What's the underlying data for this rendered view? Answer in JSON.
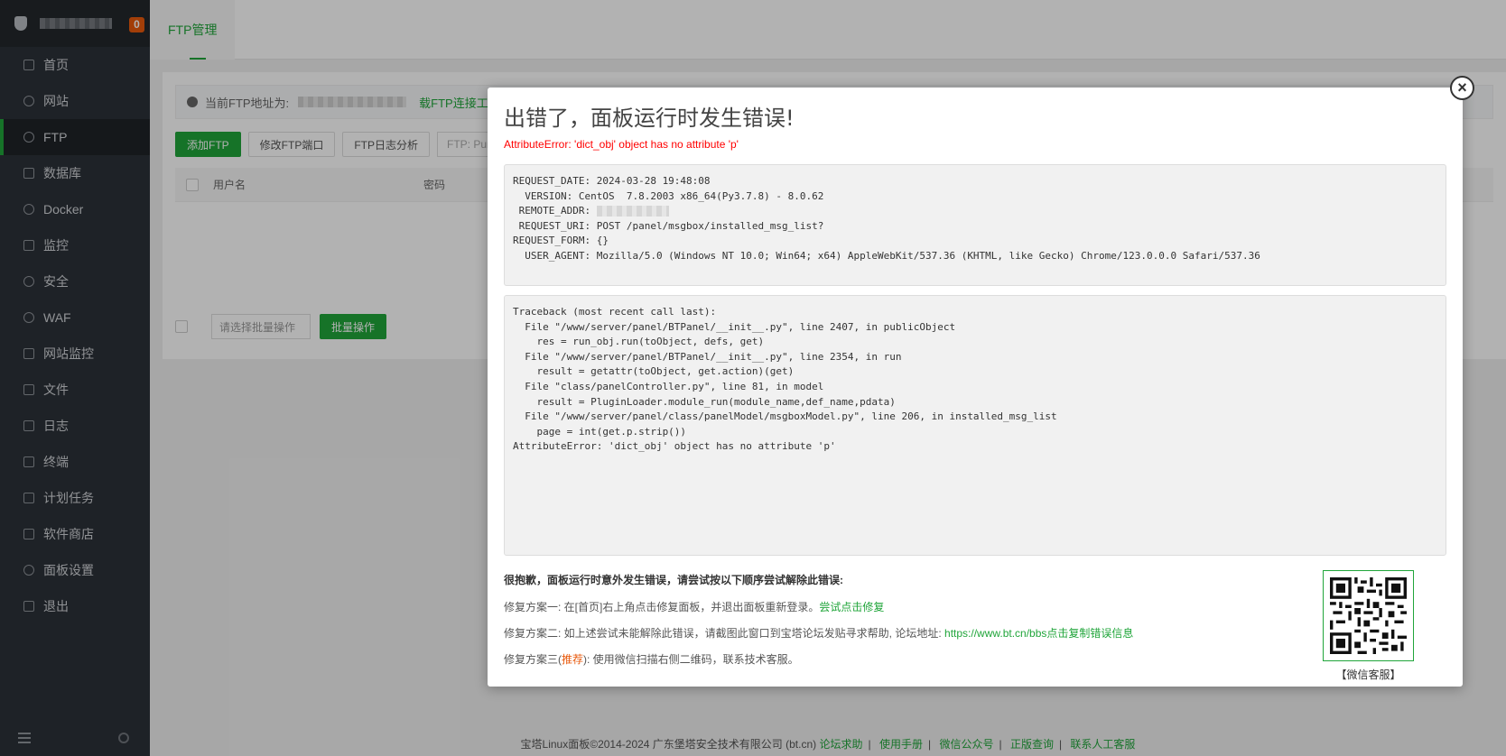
{
  "sidebar": {
    "badge": "0",
    "items": [
      {
        "label": "首页",
        "icon": "home-icon"
      },
      {
        "label": "网站",
        "icon": "globe-icon"
      },
      {
        "label": "FTP",
        "icon": "ftp-icon"
      },
      {
        "label": "数据库",
        "icon": "database-icon"
      },
      {
        "label": "Docker",
        "icon": "docker-icon"
      },
      {
        "label": "监控",
        "icon": "monitor-icon"
      },
      {
        "label": "安全",
        "icon": "shield-icon"
      },
      {
        "label": "WAF",
        "icon": "waf-icon"
      },
      {
        "label": "网站监控",
        "icon": "chart-icon"
      },
      {
        "label": "文件",
        "icon": "folder-icon"
      },
      {
        "label": "日志",
        "icon": "log-icon"
      },
      {
        "label": "终端",
        "icon": "terminal-icon"
      },
      {
        "label": "计划任务",
        "icon": "calendar-icon"
      },
      {
        "label": "软件商店",
        "icon": "apps-icon"
      },
      {
        "label": "面板设置",
        "icon": "gear-icon"
      },
      {
        "label": "退出",
        "icon": "logout-icon"
      }
    ],
    "active_index": 2
  },
  "tabs": {
    "ftp": "FTP管理"
  },
  "ftp_panel": {
    "info_label": "当前FTP地址为:",
    "download_link": "载FTP连接工具",
    "buttons": {
      "add": "添加FTP",
      "port": "修改FTP端口",
      "log": "FTP日志分析"
    },
    "search_placeholder": "FTP:  Pure-",
    "columns": {
      "user": "用户名",
      "pass": "密码"
    },
    "batch_select": "请选择批量操作",
    "batch_button": "批量操作"
  },
  "modal": {
    "title": "出错了，面板运行时发生错误!",
    "error": "AttributeError: 'dict_obj' object has no attribute 'p'",
    "request": {
      "date": "REQUEST_DATE: 2024-03-28 19:48:08",
      "version": "  VERSION: CentOS  7.8.2003 x86_64(Py3.7.8) - 8.0.62",
      "remote": " REMOTE_ADDR: ",
      "uri": " REQUEST_URI: POST /panel/msgbox/installed_msg_list?",
      "form": "REQUEST_FORM: {}",
      "agent": "  USER_AGENT: Mozilla/5.0 (Windows NT 10.0; Win64; x64) AppleWebKit/537.36 (KHTML, like Gecko) Chrome/123.0.0.0 Safari/537.36"
    },
    "traceback": "Traceback (most recent call last):\n  File \"/www/server/panel/BTPanel/__init__.py\", line 2407, in publicObject\n    res = run_obj.run(toObject, defs, get)\n  File \"/www/server/panel/BTPanel/__init__.py\", line 2354, in run\n    result = getattr(toObject, get.action)(get)\n  File \"class/panelController.py\", line 81, in model\n    result = PluginLoader.module_run(module_name,def_name,pdata)\n  File \"/www/server/panel/class/panelModel/msgboxModel.py\", line 206, in installed_msg_list\n    page = int(get.p.strip())\nAttributeError: 'dict_obj' object has no attribute 'p'",
    "help_title": "很抱歉，面板运行时意外发生错误，请尝试按以下顺序尝试解除此错误:",
    "fix1_text": "修复方案一: 在[首页]右上角点击修复面板，并退出面板重新登录。",
    "fix1_link": "尝试点击修复",
    "fix2_text": "修复方案二: 如上述尝试未能解除此错误，请截图此窗口到宝塔论坛发贴寻求帮助, 论坛地址: ",
    "fix2_link": "https://www.bt.cn/bbs",
    "fix2_copy": "点击复制错误信息",
    "fix3_prefix": "修复方案三(",
    "fix3_recommend": "推荐",
    "fix3_suffix": "): 使用微信扫描右侧二维码，联系技术客服。",
    "qr_caption": "【微信客服】"
  },
  "footer": {
    "copyright": "宝塔Linux面板©2014-2024 广东堡塔安全技术有限公司 (bt.cn)",
    "links": [
      "论坛求助",
      "使用手册",
      "微信公众号",
      "正版查询",
      "联系人工客服"
    ]
  },
  "colors": {
    "accent": "#20a53a",
    "error": "#ff0000",
    "badge": "#e8590c",
    "sidebar": "#2c3138"
  }
}
